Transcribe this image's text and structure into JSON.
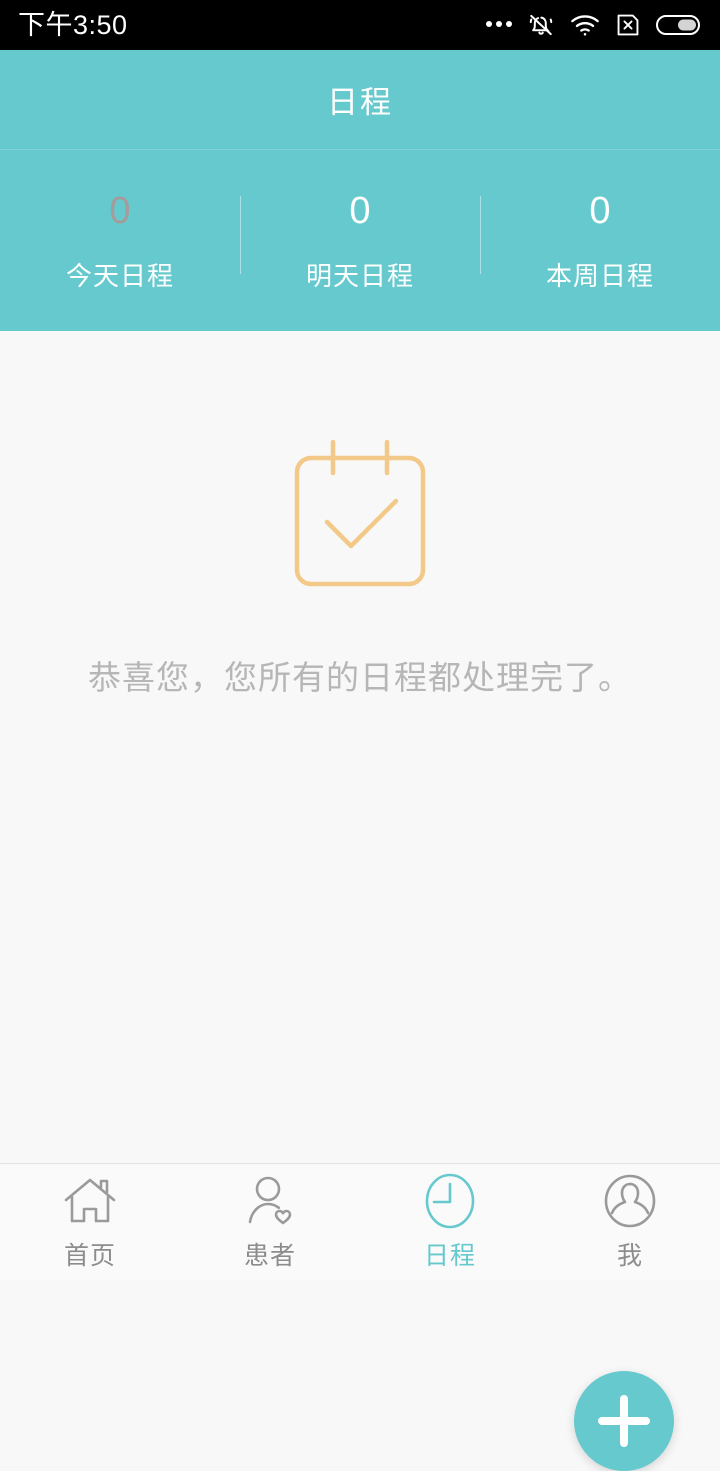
{
  "status_bar": {
    "time": "下午3:50",
    "icons": [
      {
        "name": "more-dots-icon"
      },
      {
        "name": "bell-muted-icon"
      },
      {
        "name": "wifi-icon"
      },
      {
        "name": "sim-card-x-icon"
      },
      {
        "name": "battery-icon"
      }
    ]
  },
  "header": {
    "title": "日程",
    "background_color": "#66c9ce",
    "stats": [
      {
        "value": "0",
        "label": "今天日程",
        "value_color": "#a69b9b"
      },
      {
        "value": "0",
        "label": "明天日程",
        "value_color": "#ffffff"
      },
      {
        "value": "0",
        "label": "本周日程",
        "value_color": "#ffffff"
      }
    ]
  },
  "empty_state": {
    "icon": "calendar-check-icon",
    "icon_color": "#f3c989",
    "message": "恭喜您，您所有的日程都处理完了。",
    "text_color": "#b6b6b6"
  },
  "fab": {
    "name": "add-schedule-button",
    "icon": "plus-icon",
    "color": "#66c9ce"
  },
  "bottom_nav": {
    "active_color": "#66c9ce",
    "inactive_color": "#8c8c8c",
    "items": [
      {
        "label": "首页",
        "icon": "home-icon",
        "active": false
      },
      {
        "label": "患者",
        "icon": "patient-heart-icon",
        "active": false
      },
      {
        "label": "日程",
        "icon": "clock-icon",
        "active": true
      },
      {
        "label": "我",
        "icon": "profile-avatar-icon",
        "active": false
      }
    ]
  }
}
